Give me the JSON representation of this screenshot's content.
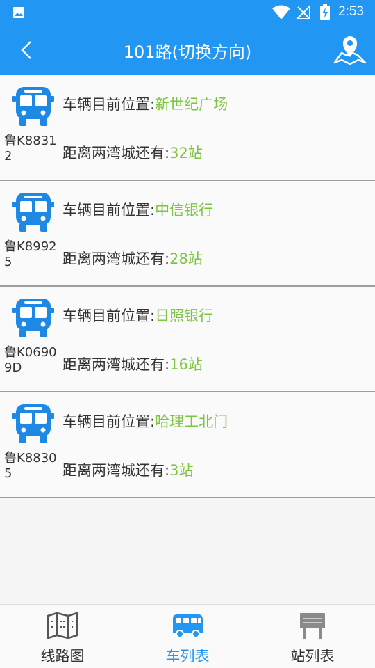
{
  "status_bar": {
    "time": "2:53",
    "icons": [
      "image-icon",
      "wifi-icon",
      "no-signal-icon",
      "battery-charging-icon"
    ]
  },
  "app_bar": {
    "title": "101路(切换方向)",
    "back_icon": "chevron-left-icon",
    "map_icon": "map-pin-icon"
  },
  "colors": {
    "primary": "#2196f3",
    "highlight": "#7cc540",
    "bus_icon": "#1e88e5",
    "inactive_icon": "#555555"
  },
  "vehicles": [
    {
      "plate": "鲁K88312",
      "position_label": "车辆目前位置:",
      "position": "新世纪广场",
      "distance_label": "距离两湾城还有:",
      "distance": "32站"
    },
    {
      "plate": "鲁K89925",
      "position_label": "车辆目前位置:",
      "position": "中信银行",
      "distance_label": "距离两湾城还有:",
      "distance": "28站"
    },
    {
      "plate": "鲁K06909D",
      "position_label": "车辆目前位置:",
      "position": "日照银行",
      "distance_label": "距离两湾城还有:",
      "distance": "16站"
    },
    {
      "plate": "鲁K88305",
      "position_label": "车辆目前位置:",
      "position": "哈理工北门",
      "distance_label": "距离两湾城还有:",
      "distance": "3站"
    }
  ],
  "tabs": [
    {
      "label": "线路图",
      "icon": "map-icon",
      "active": false
    },
    {
      "label": "车列表",
      "icon": "bus-icon",
      "active": true
    },
    {
      "label": "站列表",
      "icon": "station-sign-icon",
      "active": false
    }
  ]
}
